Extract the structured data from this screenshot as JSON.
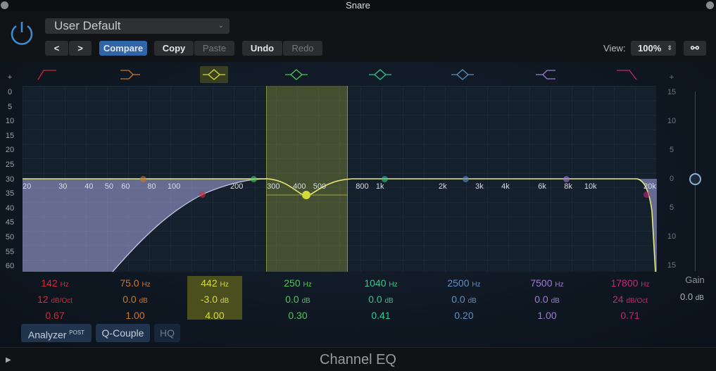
{
  "window": {
    "title": "Snare"
  },
  "header": {
    "preset": "User Default",
    "prev": "<",
    "next": ">",
    "compare": "Compare",
    "copy": "Copy",
    "paste": "Paste",
    "undo": "Undo",
    "redo": "Redo",
    "view_label": "View:",
    "view_value": "100%"
  },
  "left_scale": [
    "+",
    "0",
    "5",
    "10",
    "15",
    "20",
    "25",
    "30",
    "35",
    "40",
    "45",
    "50",
    "55",
    "60"
  ],
  "right_scale": [
    "+",
    "15",
    "10",
    "5",
    "0",
    "5",
    "10",
    "15"
  ],
  "freq_labels": [
    "20",
    "30",
    "40",
    "50",
    "60",
    "80",
    "100",
    "200",
    "300",
    "400",
    "500",
    "800",
    "1k",
    "2k",
    "3k",
    "4k",
    "6k",
    "8k",
    "10k",
    "20k"
  ],
  "bands": [
    {
      "freq": "142",
      "freq_unit": "Hz",
      "gain": "12",
      "gain_unit": "dB/Oct",
      "q": "0.67",
      "color": "#d0283c",
      "icon": "low-cut-icon"
    },
    {
      "freq": "75.0",
      "freq_unit": "Hz",
      "gain": "0.0",
      "gain_unit": "dB",
      "q": "1.00",
      "color": "#c9772e",
      "icon": "low-shelf-icon"
    },
    {
      "freq": "442",
      "freq_unit": "Hz",
      "gain": "-3.0",
      "gain_unit": "dB",
      "q": "4.00",
      "color": "#d4d93a",
      "icon": "bell-icon"
    },
    {
      "freq": "250",
      "freq_unit": "Hz",
      "gain": "0.0",
      "gain_unit": "dB",
      "q": "0.30",
      "color": "#4ec45a",
      "icon": "bell-icon"
    },
    {
      "freq": "1040",
      "freq_unit": "Hz",
      "gain": "0.0",
      "gain_unit": "dB",
      "q": "0.41",
      "color": "#35c48e",
      "icon": "bell-icon"
    },
    {
      "freq": "2500",
      "freq_unit": "Hz",
      "gain": "0.0",
      "gain_unit": "dB",
      "q": "0.20",
      "color": "#5b8fc4",
      "icon": "bell-icon"
    },
    {
      "freq": "7500",
      "freq_unit": "Hz",
      "gain": "0.0",
      "gain_unit": "dB",
      "q": "1.00",
      "color": "#a07ad6",
      "icon": "high-shelf-icon"
    },
    {
      "freq": "17800",
      "freq_unit": "Hz",
      "gain": "24",
      "gain_unit": "dB/Oct",
      "q": "0.71",
      "color": "#c0287a",
      "icon": "high-cut-icon"
    }
  ],
  "gain": {
    "label": "Gain",
    "value": "0.0",
    "unit": "dB"
  },
  "buttons": {
    "analyzer": "Analyzer",
    "analyzer_sup": "POST",
    "qcouple": "Q-Couple",
    "hq": "HQ"
  },
  "footer": {
    "title": "Channel EQ"
  }
}
